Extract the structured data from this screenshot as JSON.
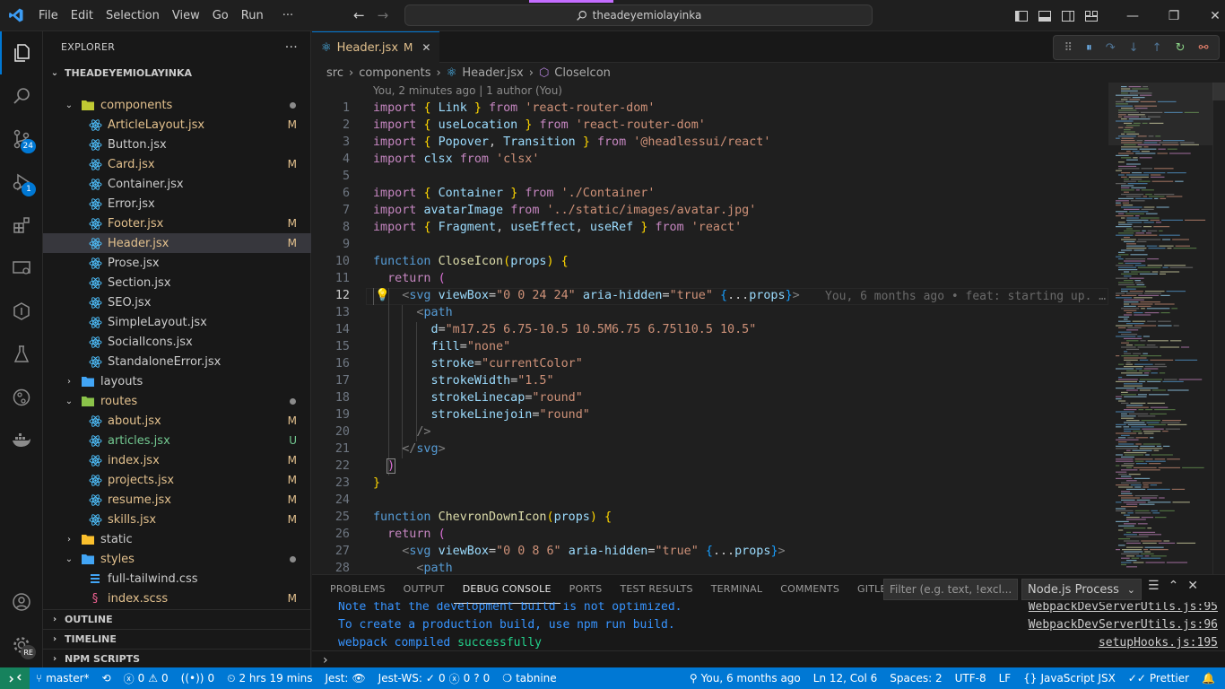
{
  "window": {
    "menu": [
      "File",
      "Edit",
      "Selection",
      "View",
      "Go",
      "Run",
      "···"
    ],
    "search_text": "theadeyemiolayinka"
  },
  "activity_bar": {
    "source_control_badge": "24",
    "debug_badge": "1"
  },
  "sidebar": {
    "title": "EXPLORER",
    "more": "···",
    "root": "THEADEYEMIOLAYINKA",
    "tree": [
      {
        "label": "components",
        "type": "folder-open",
        "status": "dot",
        "color": "modified"
      },
      {
        "label": "ArticleLayout.jsx",
        "type": "react",
        "status": "M",
        "color": "modified"
      },
      {
        "label": "Button.jsx",
        "type": "react",
        "status": "",
        "color": "normal"
      },
      {
        "label": "Card.jsx",
        "type": "react",
        "status": "M",
        "color": "modified"
      },
      {
        "label": "Container.jsx",
        "type": "react",
        "status": "",
        "color": "normal"
      },
      {
        "label": "Error.jsx",
        "type": "react",
        "status": "",
        "color": "normal"
      },
      {
        "label": "Footer.jsx",
        "type": "react",
        "status": "M",
        "color": "modified"
      },
      {
        "label": "Header.jsx",
        "type": "react",
        "status": "M",
        "color": "modified",
        "selected": true
      },
      {
        "label": "Prose.jsx",
        "type": "react",
        "status": "",
        "color": "normal"
      },
      {
        "label": "Section.jsx",
        "type": "react",
        "status": "",
        "color": "normal"
      },
      {
        "label": "SEO.jsx",
        "type": "react",
        "status": "",
        "color": "normal"
      },
      {
        "label": "SimpleLayout.jsx",
        "type": "react",
        "status": "",
        "color": "normal"
      },
      {
        "label": "SocialIcons.jsx",
        "type": "react",
        "status": "",
        "color": "normal"
      },
      {
        "label": "StandaloneError.jsx",
        "type": "react",
        "status": "",
        "color": "normal"
      },
      {
        "label": "layouts",
        "type": "folder-closed",
        "status": "",
        "color": "normal"
      },
      {
        "label": "routes",
        "type": "folder-open",
        "status": "dot",
        "color": "modified"
      },
      {
        "label": "about.jsx",
        "type": "react",
        "status": "M",
        "color": "modified"
      },
      {
        "label": "articles.jsx",
        "type": "react",
        "status": "U",
        "color": "untracked"
      },
      {
        "label": "index.jsx",
        "type": "react",
        "status": "M",
        "color": "modified"
      },
      {
        "label": "projects.jsx",
        "type": "react",
        "status": "M",
        "color": "modified"
      },
      {
        "label": "resume.jsx",
        "type": "react",
        "status": "M",
        "color": "modified"
      },
      {
        "label": "skills.jsx",
        "type": "react",
        "status": "M",
        "color": "modified"
      },
      {
        "label": "static",
        "type": "folder-closed",
        "status": "",
        "color": "normal"
      },
      {
        "label": "styles",
        "type": "folder-open",
        "status": "dot",
        "color": "modified"
      },
      {
        "label": "full-tailwind.css",
        "type": "css",
        "status": "",
        "color": "normal"
      },
      {
        "label": "index.scss",
        "type": "scss",
        "status": "M",
        "color": "modified"
      }
    ],
    "sections": [
      "OUTLINE",
      "TIMELINE",
      "NPM SCRIPTS"
    ]
  },
  "editor": {
    "tab_label": "Header.jsx",
    "tab_status": "M",
    "breadcrumb": [
      "src",
      "components",
      "Header.jsx",
      "CloseIcon"
    ],
    "blame_header": "You, 2 minutes ago | 1 author (You)",
    "inline_blame": "You, 6 months ago • feat: starting up. …",
    "line_numbers": [
      "1",
      "2",
      "3",
      "4",
      "5",
      "6",
      "7",
      "8",
      "9",
      "10",
      "11",
      "12",
      "13",
      "14",
      "15",
      "16",
      "17",
      "18",
      "19",
      "20",
      "21",
      "22",
      "23",
      "24",
      "25",
      "26",
      "27",
      "28"
    ],
    "current_line": "12"
  },
  "panel": {
    "tabs": [
      "PROBLEMS",
      "OUTPUT",
      "DEBUG CONSOLE",
      "PORTS",
      "TEST RESULTS",
      "TERMINAL",
      "COMMENTS",
      "GITLENS"
    ],
    "active_tab": "DEBUG CONSOLE",
    "filter_placeholder": "Filter (e.g. text, !excl...",
    "process": "Node.js Process",
    "output": [
      {
        "text": "Note that the development build is not optimized.",
        "source": "WebpackDevServerUtils.js:95"
      },
      {
        "text": "To create a production build, use npm run build.",
        "source": "WebpackDevServerUtils.js:96"
      },
      {
        "text": "webpack compiled ",
        "success": "successfully",
        "source": "setupHooks.js:195"
      }
    ],
    "prompt": "›"
  },
  "statusbar": {
    "branch": "master*",
    "errors": "0",
    "warnings": "0",
    "ports": "0",
    "time": "2 hrs 19 mins",
    "jest": "Jest:",
    "jest_ws": "Jest-WS:",
    "jest_ws_pass": "0",
    "jest_ws_fail": "0",
    "jest_ws_unknown": "0",
    "tabnine": "tabnine",
    "blame": "You, 6 months ago",
    "position": "Ln 12, Col 6",
    "spaces": "Spaces: 2",
    "encoding": "UTF-8",
    "eol": "LF",
    "language": "JavaScript JSX",
    "prettier": "Prettier"
  },
  "colors": {
    "accent": "#0078d4",
    "modified": "#e2c08d",
    "untracked": "#73c991",
    "success": "#23d18b"
  }
}
